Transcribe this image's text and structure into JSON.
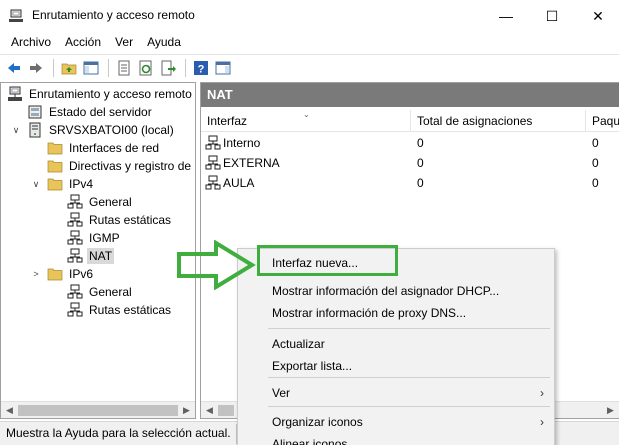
{
  "window": {
    "title": "Enrutamiento y acceso remoto",
    "min_glyph": "—",
    "max_glyph": "☐",
    "close_glyph": "✕"
  },
  "menubar": [
    "Archivo",
    "Acción",
    "Ver",
    "Ayuda"
  ],
  "toolbar": {
    "buttons": [
      "back-icon",
      "forward-icon",
      "up-folder-icon",
      "show-hide-tree-icon",
      "properties-icon",
      "refresh-icon",
      "export-list-icon",
      "help-icon",
      "show-hide-action-pane-icon"
    ]
  },
  "tree": {
    "items": [
      {
        "label": "Enrutamiento y acceso remoto",
        "icon": "server-tree-icon"
      },
      {
        "label": "Estado del servidor",
        "icon": "server-status-icon"
      },
      {
        "label": "SRVSXBATOI00 (local)",
        "icon": "server-icon",
        "expander": "∨"
      },
      {
        "label": "Interfaces de red",
        "icon": "folder-icon"
      },
      {
        "label": "Directivas y registro de a",
        "icon": "folder-icon"
      },
      {
        "label": "IPv4",
        "icon": "folder-icon",
        "expander": "∨"
      },
      {
        "label": "General",
        "icon": "network-icon"
      },
      {
        "label": "Rutas estáticas",
        "icon": "network-icon"
      },
      {
        "label": "IGMP",
        "icon": "network-icon"
      },
      {
        "label": "NAT",
        "icon": "network-icon",
        "selected": true
      },
      {
        "label": "IPv6",
        "icon": "folder-icon",
        "expander": ">"
      },
      {
        "label": "General",
        "icon": "network-icon"
      },
      {
        "label": "Rutas estáticas",
        "icon": "network-icon"
      }
    ]
  },
  "right": {
    "header": "NAT",
    "columns": [
      "Interfaz",
      "Total de asignaciones",
      "Paqu"
    ],
    "rows": [
      {
        "name": "Interno",
        "total": "0",
        "packets": "0"
      },
      {
        "name": "EXTERNA",
        "total": "0",
        "packets": "0"
      },
      {
        "name": "AULA",
        "total": "0",
        "packets": "0"
      }
    ]
  },
  "context_menu": {
    "items": [
      {
        "label": "Interfaz nueva..."
      },
      {
        "label": "Mostrar información del asignador DHCP..."
      },
      {
        "label": "Mostrar información de proxy DNS..."
      },
      {
        "label": "Actualizar"
      },
      {
        "label": "Exportar lista..."
      },
      {
        "label": "Ver",
        "submenu": "›"
      },
      {
        "label": "Organizar iconos",
        "submenu": "›"
      },
      {
        "label": "Alinear iconos"
      }
    ]
  },
  "status": {
    "text": "Muestra la Ayuda para la selección actual."
  },
  "colors": {
    "header_bg": "#7a7a7a",
    "annotation_green": "#3fae3f",
    "toolbar_blue": "#1e6fc8"
  }
}
